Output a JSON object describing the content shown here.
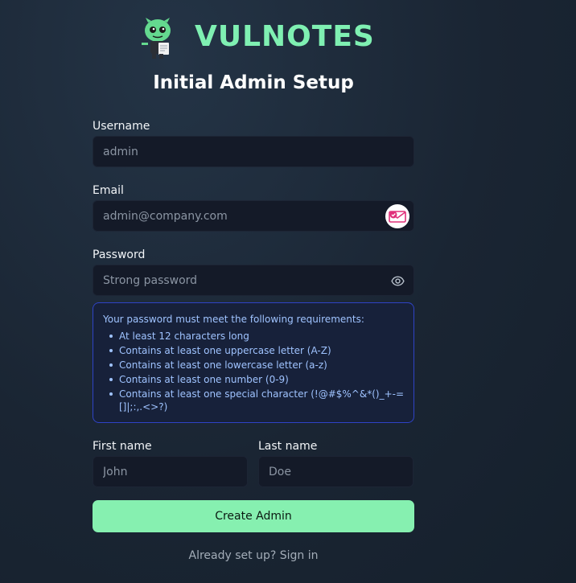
{
  "brand": {
    "name": "VULNOTES",
    "mascot_icon": "mascot-icon",
    "color": "#7ff0b2"
  },
  "page": {
    "title": "Initial Admin Setup"
  },
  "form": {
    "username": {
      "label": "Username",
      "placeholder": "admin",
      "value": ""
    },
    "email": {
      "label": "Email",
      "placeholder": "admin@company.com",
      "value": "",
      "icon": "mail-badge-icon"
    },
    "password": {
      "label": "Password",
      "placeholder": "Strong password",
      "value": "",
      "icon": "eye-icon"
    },
    "requirements": {
      "intro": "Your password must meet the following requirements:",
      "items": [
        "At least 12 characters long",
        "Contains at least one uppercase letter (A-Z)",
        "Contains at least one lowercase letter (a-z)",
        "Contains at least one number (0-9)",
        "Contains at least one special character (!@#$%^&*()_+-=[]|;:,.<>?)"
      ]
    },
    "first_name": {
      "label": "First name",
      "placeholder": "John",
      "value": ""
    },
    "last_name": {
      "label": "Last name",
      "placeholder": "Doe",
      "value": ""
    },
    "submit_label": "Create Admin"
  },
  "footer": {
    "prompt": "Already set up?",
    "link": "Sign in"
  },
  "colors": {
    "accent": "#86f0b2",
    "requirements_border": "#2f43c6",
    "requirements_text": "#9fc3ff",
    "input_bg": "#141a28"
  }
}
